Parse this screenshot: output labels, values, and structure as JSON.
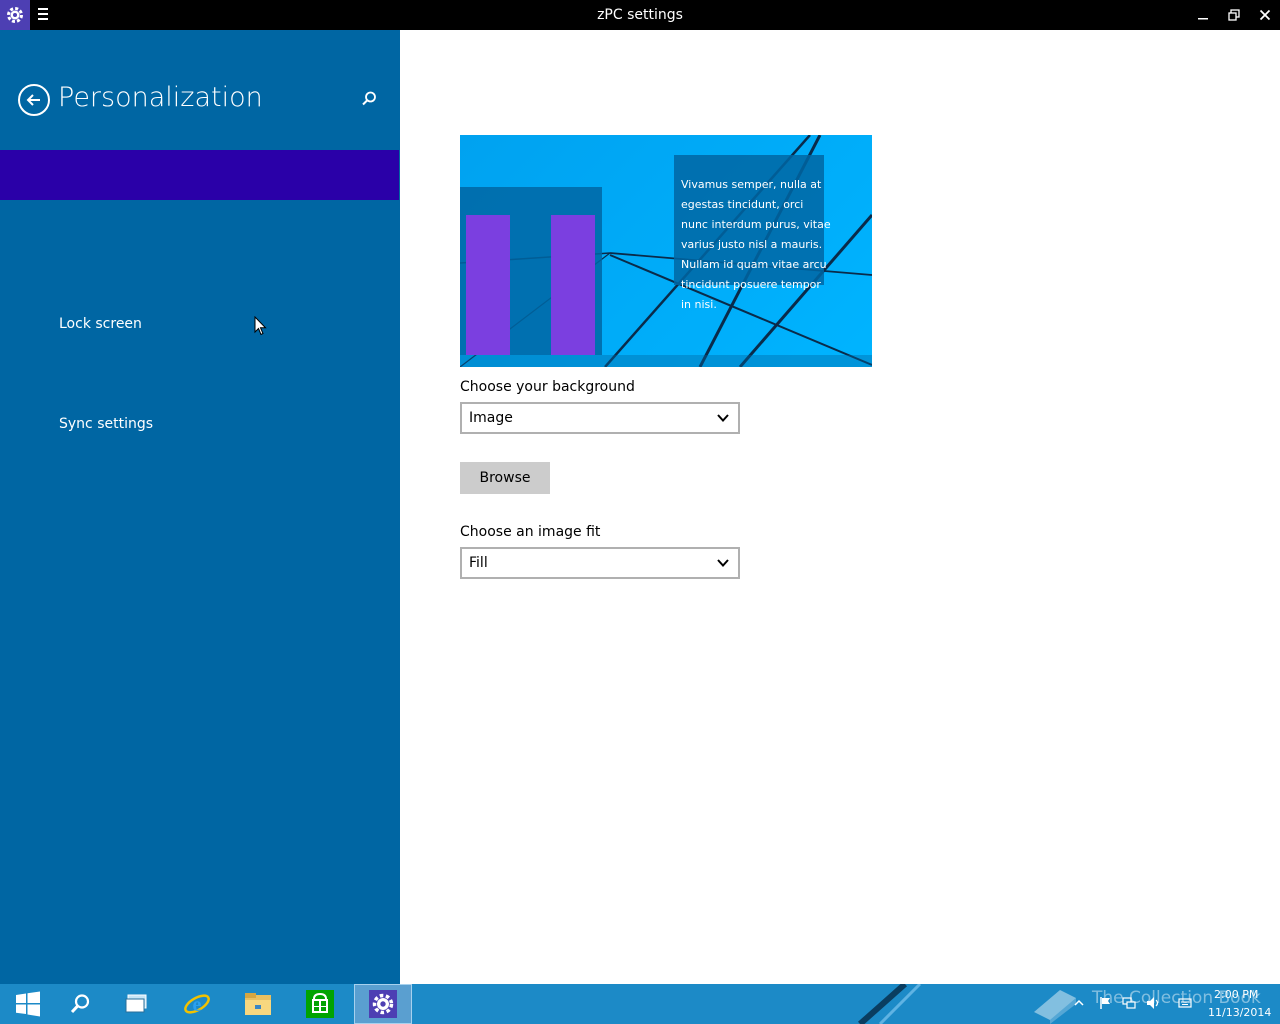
{
  "window": {
    "title": "zPC settings"
  },
  "sidebar": {
    "title": "Personalization",
    "items": [
      {
        "label": "Lock screen"
      },
      {
        "label": "Sync settings"
      }
    ]
  },
  "preview": {
    "sample_text": "Vivamus semper, nulla at egestas tincidunt, orci nunc interdum purus, vitae varius justo nisl a mauris. Nullam id quam vitae arcu tincidunt posuere tempor in nisi."
  },
  "background": {
    "label": "Choose your background",
    "value": "Image"
  },
  "browse": {
    "label": "Browse"
  },
  "fit": {
    "label": "Choose an image fit",
    "value": "Fill"
  },
  "taskbar": {
    "watermark": "The Collection Book",
    "time": "2:00 PM",
    "date": "11/13/2014"
  },
  "colors": {
    "sidebar": "#0066a3",
    "selected": "#2a00a8",
    "taskbar": "#1c8ac7",
    "accent": "#7b3fe0"
  }
}
